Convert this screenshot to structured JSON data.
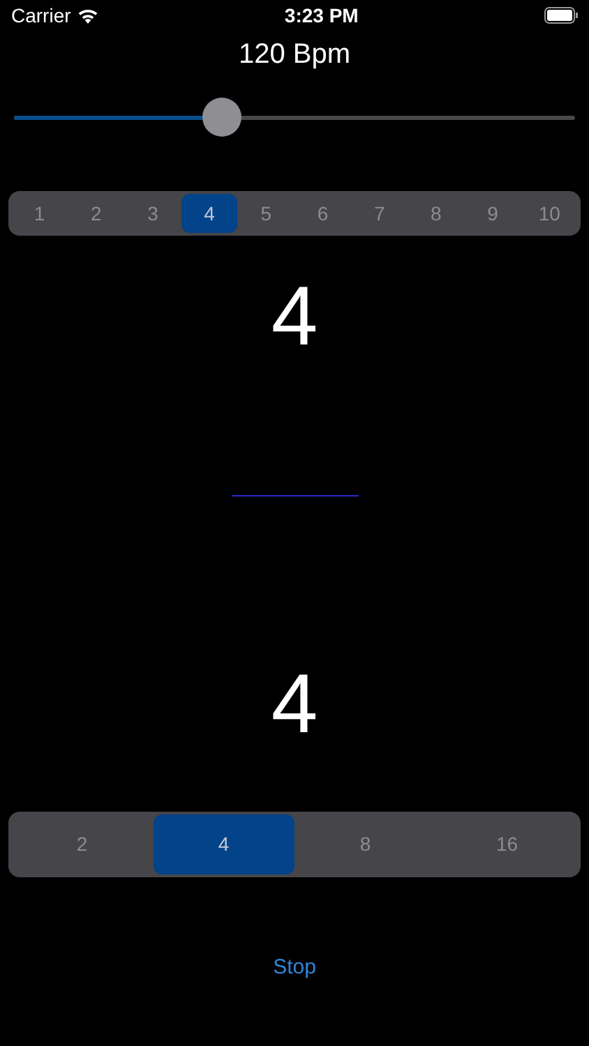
{
  "status_bar": {
    "carrier": "Carrier",
    "time": "3:23 PM"
  },
  "tempo": {
    "reading": "120 Bpm",
    "level": 0.37
  },
  "beats": [
    {
      "label": "1",
      "selected": false
    },
    {
      "label": "2",
      "selected": false
    },
    {
      "label": "3",
      "selected": false
    },
    {
      "label": "4",
      "selected": true
    },
    {
      "label": "5",
      "selected": false
    },
    {
      "label": "6",
      "selected": false
    },
    {
      "label": "7",
      "selected": false
    },
    {
      "label": "8",
      "selected": false
    },
    {
      "label": "9",
      "selected": false
    },
    {
      "label": "10",
      "selected": false
    }
  ],
  "time_signature": {
    "numerator": "4",
    "denominator": "4"
  },
  "note_values": [
    {
      "label": "2",
      "selected": false
    },
    {
      "label": "4",
      "selected": true
    },
    {
      "label": "8",
      "selected": false
    },
    {
      "label": "16",
      "selected": false
    }
  ],
  "stop_button": "Stop"
}
